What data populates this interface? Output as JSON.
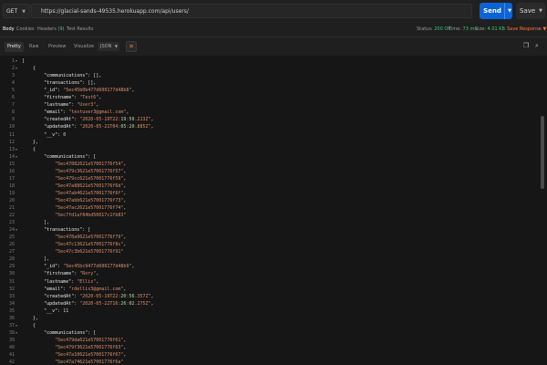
{
  "request": {
    "method": "GET",
    "url": "https://glacial-sands-49535.herokuapp.com/api/users/",
    "send_label": "Send",
    "save_label": "Save"
  },
  "response_tabs": [
    {
      "label": "Body",
      "active": true
    },
    {
      "label": "Cookies"
    },
    {
      "label": "Headers",
      "badge": "(9)"
    },
    {
      "label": "Test Results"
    }
  ],
  "status": {
    "status_label": "Status:",
    "status_value": "200 OK",
    "time_label": "Time:",
    "time_value": "73 ms",
    "size_label": "Size:",
    "size_value": "4.01 KB",
    "save_response": "Save Response"
  },
  "view_modes": [
    "Pretty",
    "Raw",
    "Preview",
    "Visualize"
  ],
  "format": "JSON",
  "icons": {
    "copy": "copy-icon",
    "search": "search-icon",
    "wrap": "wrap-lines-icon"
  },
  "colors": {
    "accent": "#0c63d6",
    "status_ok": "#45c56b",
    "save_response": "#ff7a3d",
    "string": "#d98f6c"
  },
  "code_lines": [
    "[",
    "    {",
    "        \"communications\": [],",
    "        \"transactions\": [],",
    "        \"_id\": \"5ec45b0b477d600177d48b8\",",
    "        \"firstname\": \"Test6\",",
    "        \"lastname\": \"User3\",",
    "        \"email\": \"testuser3@gmail.com\",",
    "        \"createdAt\": \"2020-05-19T22:19:50.213Z\",",
    "        \"updatedAt\": \"2020-05-21T04:05:20.885Z\",",
    "        \"__v\": 0",
    "    },",
    "    {",
    "        \"communications\": [",
    "            \"5ec47882621e57001776f54\",",
    "            \"5ec479c3621e57001776f57\",",
    "            \"5ec479cc621e57001776f59\",",
    "            \"5ec47a88621e57001776f6d\",",
    "            \"5ec47ab4621e57001776f6f\",",
    "            \"5ec47abb621e57001776f73\",",
    "            \"5ec47ac2621e57001776f74\",",
    "            \"5ec7fd1af84bd50017c1fb83\"",
    "        ],",
    "        \"transactions\": [",
    "            \"5ec478a9621e57001776f79\",",
    "            \"5ec47c13621e57001776f8c\",",
    "            \"5ec47c3b621e57001776f91\"",
    "        ],",
    "        \"_id\": \"5ec45bc9477d600177d48b9\",",
    "        \"firstname\": \"Rory\",",
    "        \"lastname\": \"Ellis\",",
    "        \"email\": \"rdellis3@gmail.com\",",
    "        \"createdAt\": \"2020-05-19T22:20:56.357Z\",",
    "        \"updatedAt\": \"2020-05-22T16:26:02.275Z\",",
    "        \"__v\": 11",
    "    },",
    "    {",
    "        \"communications\": [",
    "            \"5ec479da621e57001776f61\",",
    "            \"5ec479f3621e57001776f63\",",
    "            \"5ec47a10621e57001776f67\",",
    "            \"5ec47a74621e57001776f6a\""
  ]
}
